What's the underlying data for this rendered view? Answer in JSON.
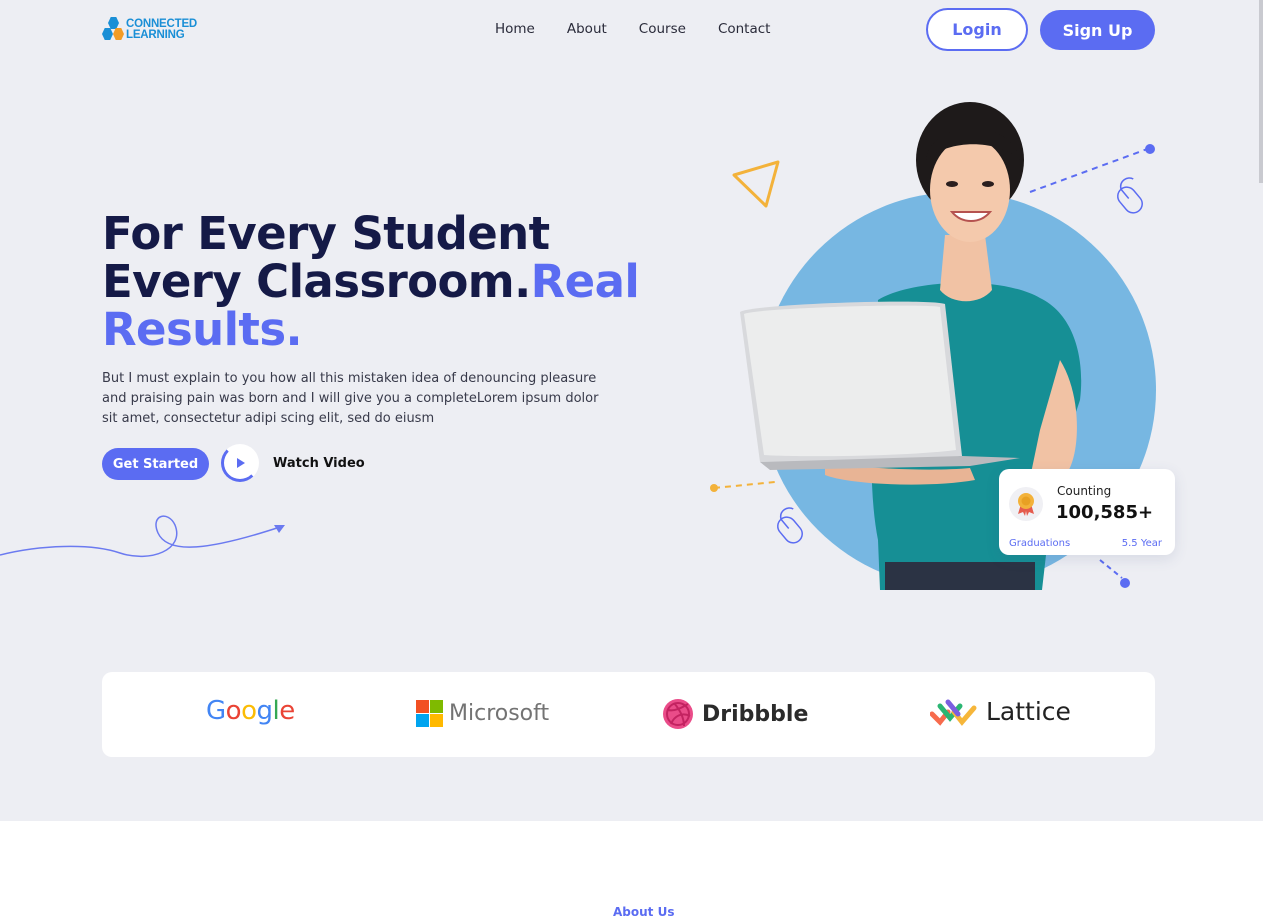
{
  "brand": {
    "logo_line1": "CONNECTED",
    "logo_line2": "LEARNING"
  },
  "nav": {
    "items": [
      {
        "label": "Home"
      },
      {
        "label": "About"
      },
      {
        "label": "Course"
      },
      {
        "label": "Contact"
      }
    ]
  },
  "auth": {
    "login_label": "Login",
    "signup_label": "Sign Up"
  },
  "hero": {
    "headline_line1": "For Every Student",
    "headline_line2": "Every Classroom.",
    "headline_accent1": "Real",
    "headline_accent2": "Results.",
    "description": "But I must explain to you how all this mistaken idea of denouncing pleasure and praising pain was born and I will give you a completeLorem ipsum dolor sit amet, consectetur adipi scing elit, sed do eiusm",
    "cta_label": "Get Started",
    "video_label": "Watch Video"
  },
  "stats_card": {
    "label": "Counting",
    "value": "100,585+",
    "footer_left": "Graduations",
    "footer_right": "5.5 Year"
  },
  "partners": [
    {
      "name": "Google"
    },
    {
      "name": "Microsoft"
    },
    {
      "name": "Dribbble"
    },
    {
      "name": "Lattice"
    }
  ],
  "next_section": {
    "label": "About Us"
  },
  "colors": {
    "accent": "#5b6cf2",
    "hero_bg": "#edeef3",
    "circle": "#77b7e2",
    "headline": "#151a47",
    "logo": "#1a8fd6"
  }
}
